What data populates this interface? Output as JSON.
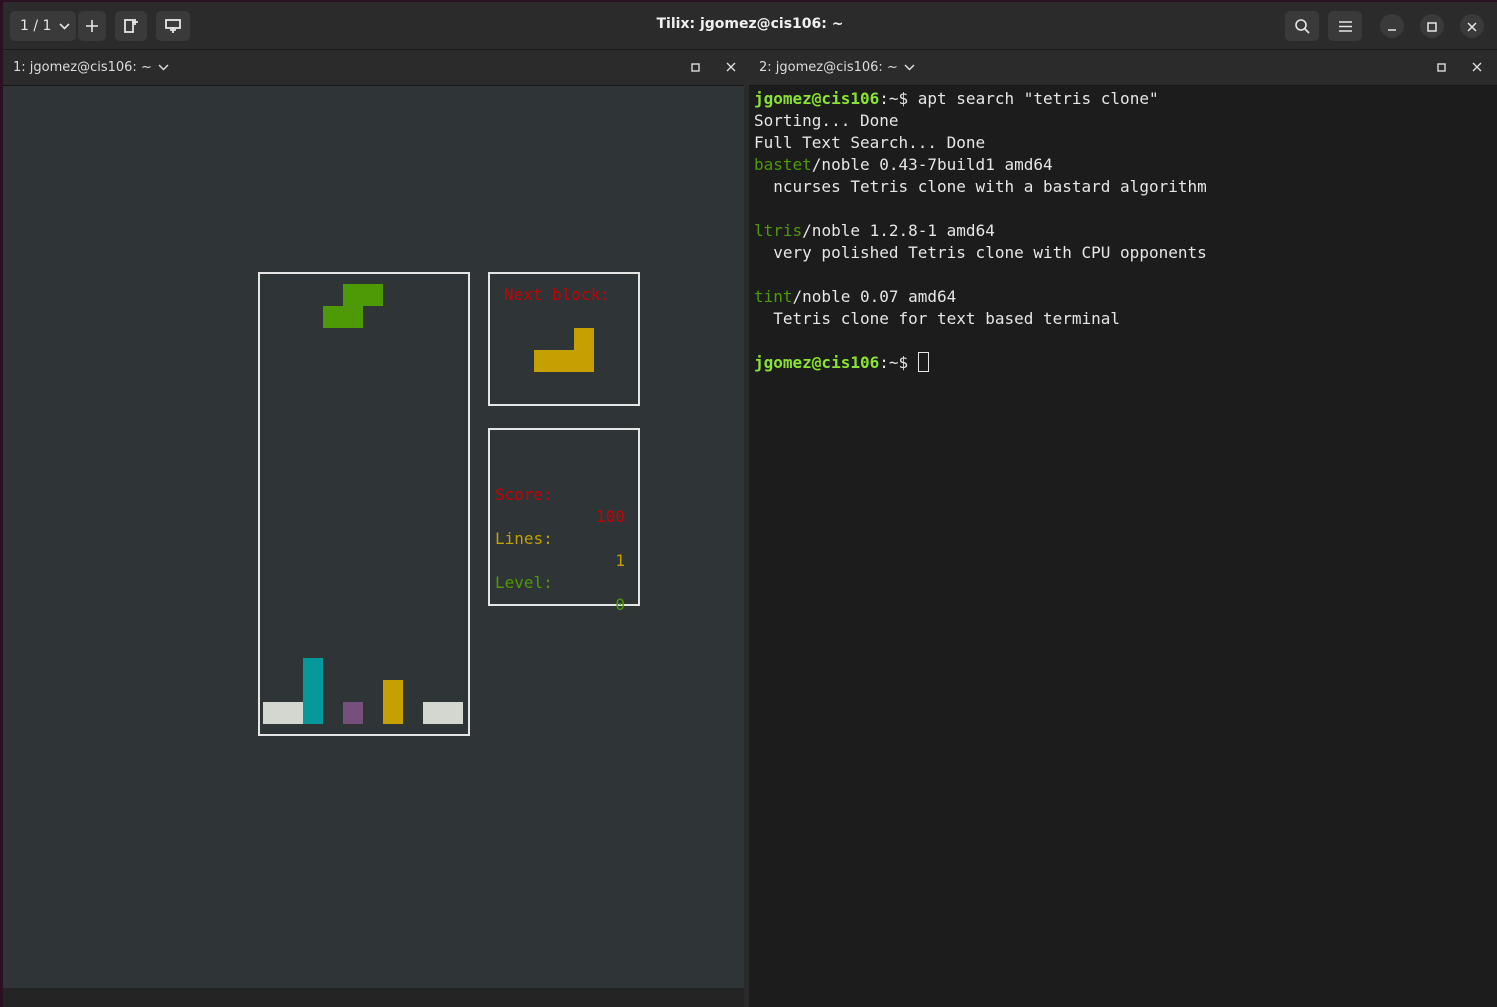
{
  "window": {
    "title": "Tilix: jgomez@cis106: ~"
  },
  "toolbar": {
    "session_label": "1 / 1"
  },
  "panes": [
    {
      "label": "1: jgomez@cis106: ~"
    },
    {
      "label": "2: jgomez@cis106: ~"
    }
  ],
  "tetris": {
    "next_label": "Next block:",
    "score_label": "Score:",
    "score_value": "100",
    "lines_label": "Lines:",
    "lines_value": "1",
    "level_label": "Level:",
    "level_value": "0",
    "colors": {
      "green": "#4e9a06",
      "yellow": "#c4a000",
      "cyan": "#06989a",
      "purple": "#75507b",
      "white": "#d3d7cf",
      "red": "#cc0000"
    }
  },
  "terminal": {
    "prompt_user": "jgomez@cis106",
    "prompt_path": ":~$ ",
    "command": "apt search \"tetris clone\"",
    "line_sorting": "Sorting... Done",
    "line_fts": "Full Text Search... Done",
    "results": [
      {
        "name": "bastet",
        "info": "/noble 0.43-7build1 amd64",
        "desc": "  ncurses Tetris clone with a bastard algorithm"
      },
      {
        "name": "ltris",
        "info": "/noble 1.2.8-1 amd64",
        "desc": "  very polished Tetris clone with CPU opponents"
      },
      {
        "name": "tint",
        "info": "/noble 0.07 amd64",
        "desc": "  Tetris clone for text based terminal"
      }
    ]
  }
}
